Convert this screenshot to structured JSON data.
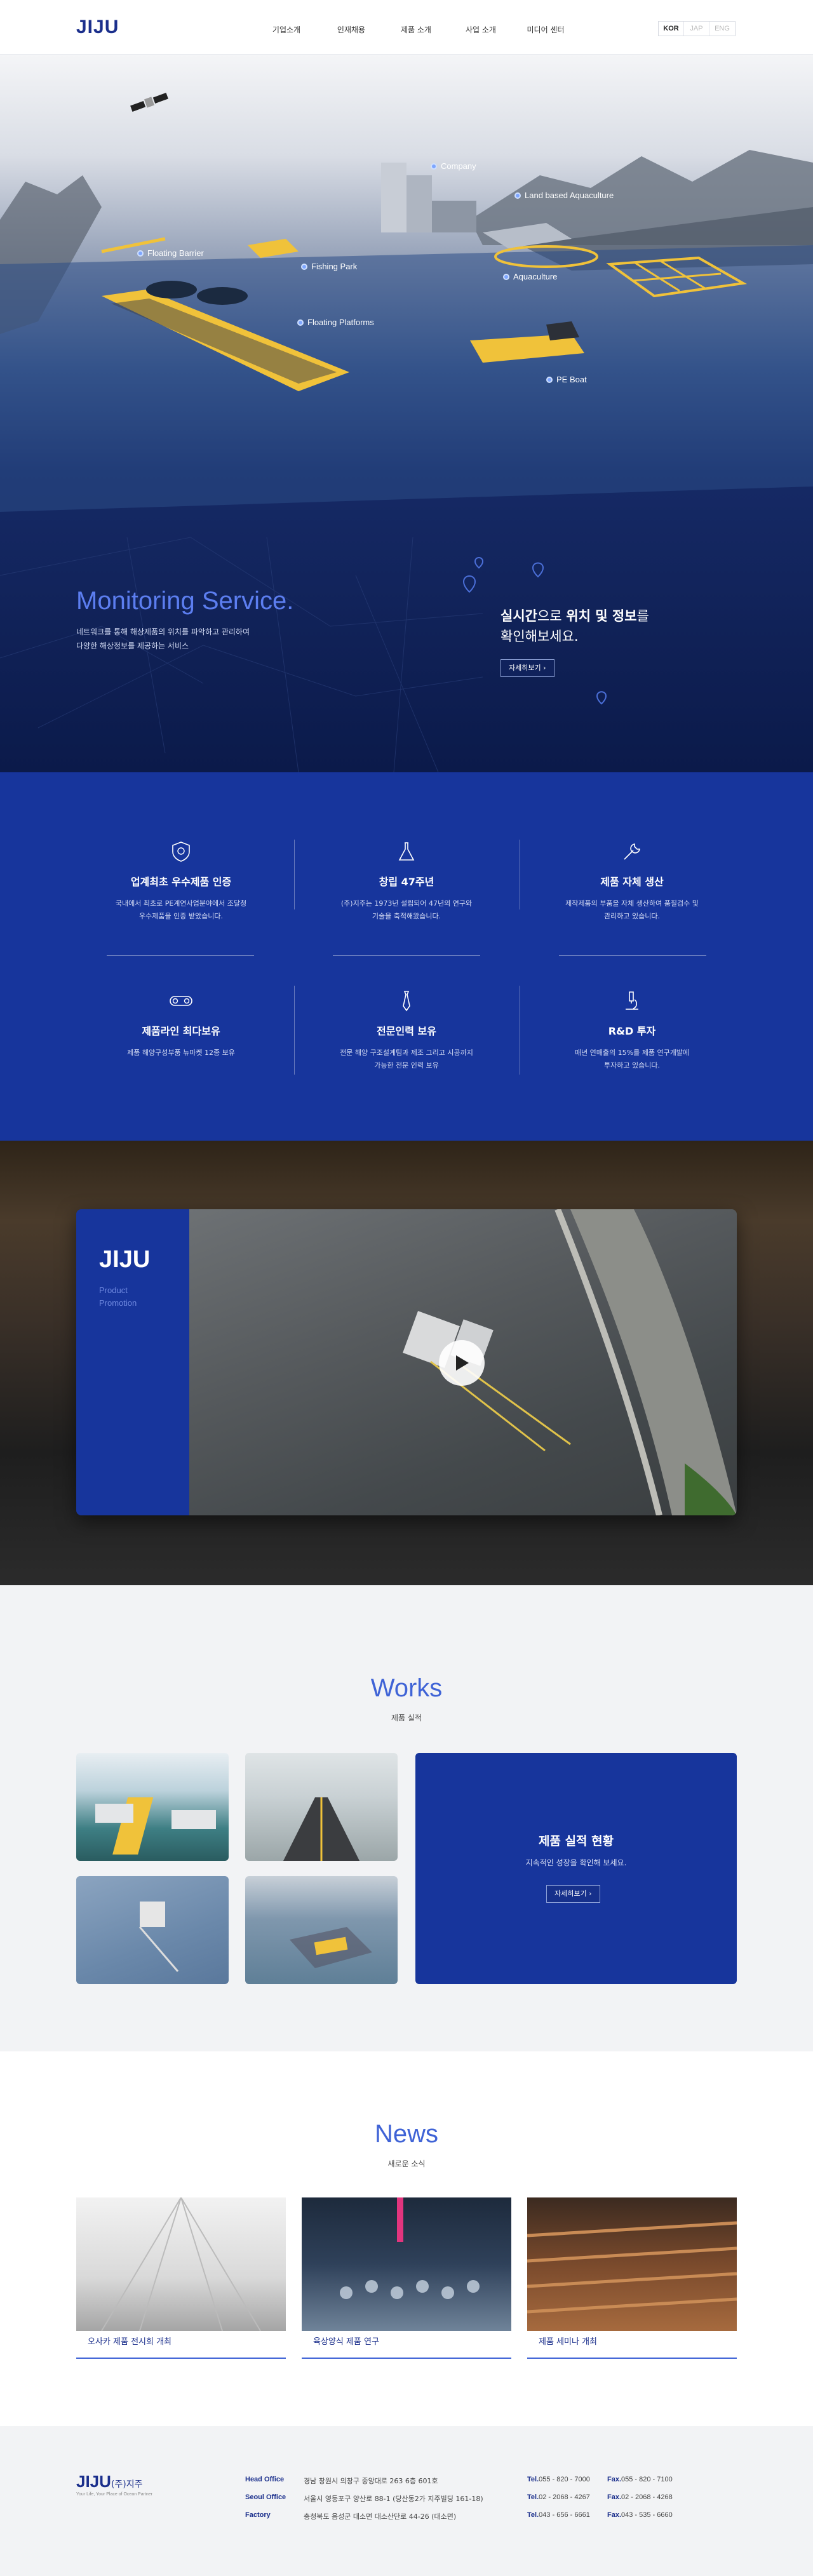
{
  "header": {
    "logo": "JIJU",
    "nav": [
      "기업소개",
      "인재채용",
      "제품 소개",
      "사업 소개",
      "미디어 센터"
    ],
    "languages": [
      "KOR",
      "JAP",
      "ENG"
    ],
    "active_language": "KOR"
  },
  "hero": {
    "map_labels": [
      "Company",
      "Land based Aquaculture",
      "Floating Barrier",
      "Fishing Park",
      "Aquaculture",
      "Floating Platforms",
      "PE Boat"
    ],
    "monitoring_title": "Monitoring Service.",
    "monitoring_desc_1": "네트워크를 통해 해상제품의 위치를 파악하고 관리하여",
    "monitoring_desc_2": "다양한 해상정보를 제공하는 서비스",
    "realtime_em1": "실시간",
    "realtime_mid": "으로 ",
    "realtime_em2": "위치 및 정보",
    "realtime_end": "를",
    "realtime_line2": "확인해보세요.",
    "more_button": "자세히보기"
  },
  "features": [
    {
      "icon": "shield-icon",
      "title": "업계최초 우수제품 인증",
      "desc_1": "국내에서 최초로 PE계연사업분야에서 조달청",
      "desc_2": "우수제품을 인증 받았습니다."
    },
    {
      "icon": "flask-icon",
      "title": "창립 47주년",
      "desc_1": "(주)지주는 1973년 설립되어 47년의 연구와",
      "desc_2": "기술을 축적해왔습니다."
    },
    {
      "icon": "wrench-icon",
      "title": "제품 자체 생산",
      "desc_1": "제작제품의 부품을 자체 생산하여 품질검수 및",
      "desc_2": "관리하고 있습니다."
    },
    {
      "icon": "conveyor-icon",
      "title": "제품라인 최다보유",
      "desc_1": "제품 해양구성부품 뉴마켓 12종 보유",
      "desc_2": ""
    },
    {
      "icon": "tie-icon",
      "title": "전문인력 보유",
      "desc_1": "전문 해양 구조설계팀과 제조 그리고 시공까지",
      "desc_2": "가능한 전문 인력 보유"
    },
    {
      "icon": "microscope-icon",
      "title": "R&D 투자",
      "desc_1": "매년 연매출의 15%를 제품 연구개발에",
      "desc_2": "투자하고 있습니다."
    }
  ],
  "video": {
    "brand": "JIJU",
    "caption_1": "Product",
    "caption_2": "Promotion"
  },
  "works": {
    "title": "Works",
    "subtitle": "제품 실적",
    "box_title": "제품 실적 현황",
    "box_desc": "지속적인 성장을 확인해 보세요.",
    "box_button": "자세히보기"
  },
  "news": {
    "title": "News",
    "subtitle": "새로운 소식",
    "items": [
      "오사카 제품 전시회 개최",
      "육상양식 제품 연구",
      "제품 세미나 개최"
    ]
  },
  "footer": {
    "logo": "JIJU",
    "logo_kr": "(주)지주",
    "tagline": "Your Life, Your Place of Ocean Partner",
    "rows": [
      {
        "label": "Head Office",
        "address": "경남 창원시 의창구 중앙대로 263 6층 601호",
        "tel": "055 - 820 - 7000",
        "fax": "055 - 820 - 7100"
      },
      {
        "label": "Seoul Office",
        "address": "서울시 영등포구 양산로 88-1 (당산동2가 지주빌딩 161-18)",
        "tel": "02 - 2068 - 4267",
        "fax": "02 - 2068 - 4268"
      },
      {
        "label": "Factory",
        "address": "충청북도 음성군 대소면 대소산단로 44-26 (대소면)",
        "tel": "043 - 656 - 6661",
        "fax": "043 - 535 - 6660"
      }
    ],
    "tel_label": "Tel.",
    "fax_label": "Fax."
  },
  "colors": {
    "primary": "#17359c",
    "accent": "#3f63d6",
    "logo": "#1b2f8c"
  }
}
